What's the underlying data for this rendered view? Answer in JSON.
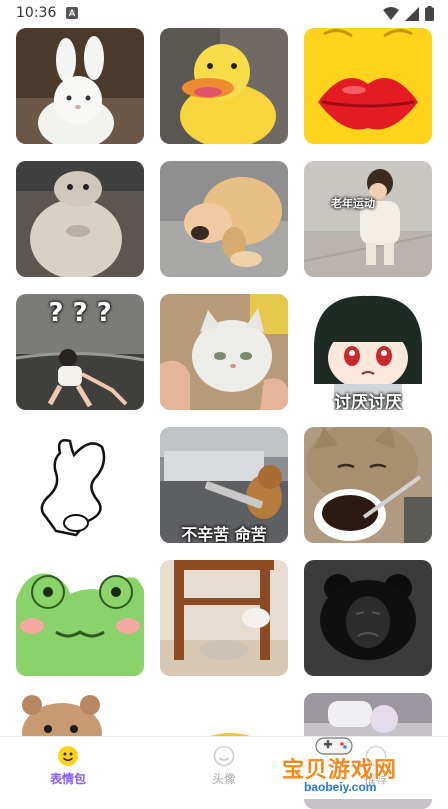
{
  "status_bar": {
    "time": "10:36",
    "notification_icon": "a-badge-icon",
    "icons": [
      "wifi-icon",
      "signal-icon",
      "battery-icon"
    ]
  },
  "stickers": [
    {
      "name": "white-bunny"
    },
    {
      "name": "yellow-duck"
    },
    {
      "name": "lips-emoji"
    },
    {
      "name": "chinchilla"
    },
    {
      "name": "puppy"
    },
    {
      "name": "child-exercising",
      "caption": "老年运动"
    },
    {
      "name": "kid-question",
      "caption": "? ? ?"
    },
    {
      "name": "cat-hand"
    },
    {
      "name": "anime-girl",
      "caption": "讨厌讨厌"
    },
    {
      "name": "doodle-figure"
    },
    {
      "name": "dog-kitchen",
      "caption": "不辛苦 命苦"
    },
    {
      "name": "cat-soup"
    },
    {
      "name": "frog"
    },
    {
      "name": "cat-chair"
    },
    {
      "name": "panda-meme"
    },
    {
      "name": "hamster"
    },
    {
      "name": "emoji-partial"
    },
    {
      "name": "game-partial"
    }
  ],
  "tabs": [
    {
      "label": "表情包",
      "icon": "smiley-icon",
      "active": true
    },
    {
      "label": "头像",
      "icon": "avatar-icon",
      "active": false
    },
    {
      "label": "推荐",
      "icon": "recommend-icon",
      "active": false
    }
  ],
  "watermark": {
    "title": "宝贝游戏网",
    "url": "baobeiy.com"
  },
  "colors": {
    "active_tab": "#8b5cf6",
    "inactive_tab": "#999999",
    "icon_yellow": "#ffd21f"
  }
}
